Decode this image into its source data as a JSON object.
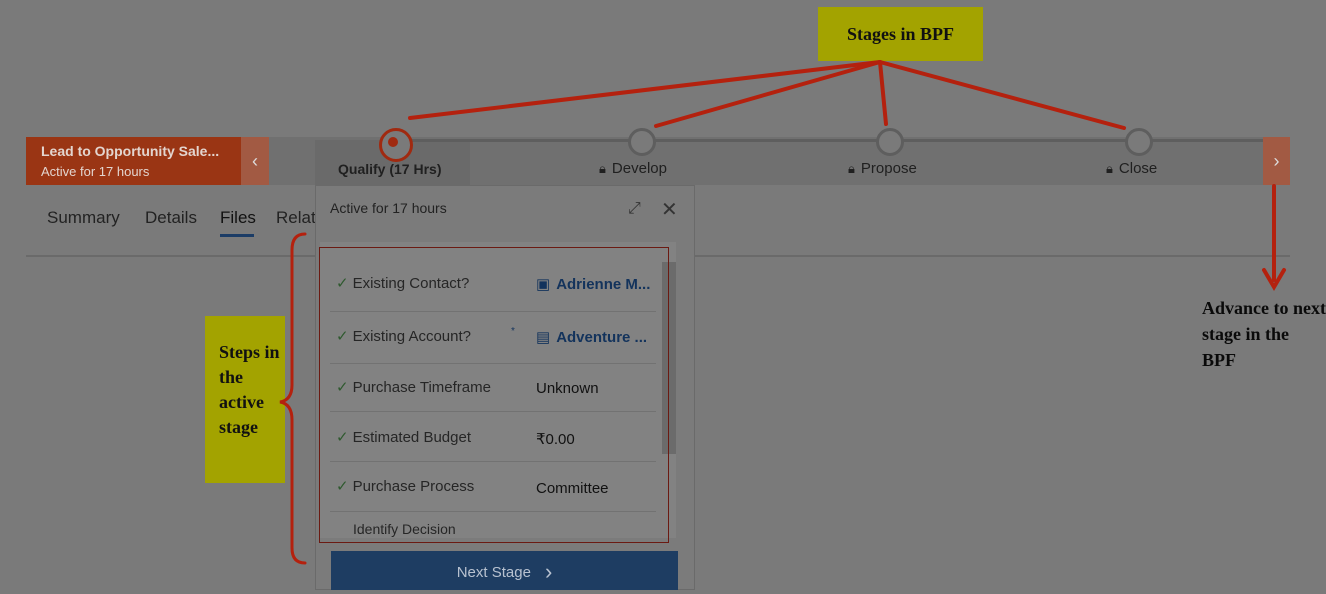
{
  "bpf": {
    "process_name": "Lead to Opportunity Sale...",
    "process_status": "Active for 17 hours",
    "prev_glyph": "‹",
    "next_glyph": "›",
    "stages": [
      {
        "label": "Qualify  (17 Hrs)",
        "active": true
      },
      {
        "label": "Develop",
        "locked": true
      },
      {
        "label": "Propose",
        "locked": true
      },
      {
        "label": "Close",
        "locked": true
      }
    ]
  },
  "tabs": [
    "Summary",
    "Details",
    "Files",
    "Relat"
  ],
  "active_tab": "Files",
  "flyout": {
    "header": "Active for 17 hours",
    "steps": [
      {
        "label": "Existing Contact?",
        "value": "Adrienne M...",
        "checked": true,
        "icon": "contact-card-icon",
        "link": true
      },
      {
        "label": "Existing Account?",
        "value": "Adventure ...",
        "checked": true,
        "icon": "account-icon",
        "link": true,
        "required": "*"
      },
      {
        "label": "Purchase Timeframe",
        "value": "Unknown",
        "checked": true
      },
      {
        "label": "Estimated Budget",
        "value": "₹0.00",
        "checked": true
      },
      {
        "label": "Purchase Process",
        "value": "Committee",
        "checked": true
      },
      {
        "label": "Identify Decision",
        "value": "",
        "checked": false
      }
    ],
    "next_stage_label": "Next Stage",
    "next_stage_glyph": "›"
  },
  "annotations": {
    "stages_callout": "Stages in BPF",
    "steps_callout": "Steps in the active stage",
    "advance_note": "Advance to next stage in the BPF"
  },
  "colors": {
    "annotation_red": "#b4210e",
    "callout_yellow": "#a3a300",
    "active_stage": "#a02a10"
  }
}
